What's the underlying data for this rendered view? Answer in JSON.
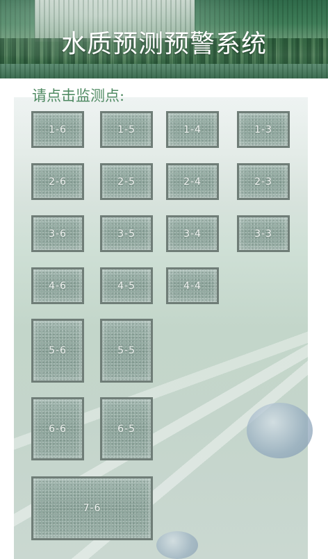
{
  "header": {
    "title": "水质预测预警系统"
  },
  "main": {
    "prompt": "请点击监测点:",
    "points": [
      "1-6",
      "1-5",
      "1-4",
      "1-3",
      "2-6",
      "2-5",
      "2-4",
      "2-3",
      "3-6",
      "3-5",
      "3-4",
      "3-3",
      "4-6",
      "4-5",
      "4-4",
      "5-6",
      "5-5",
      "6-6",
      "6-5",
      "7-6"
    ]
  }
}
